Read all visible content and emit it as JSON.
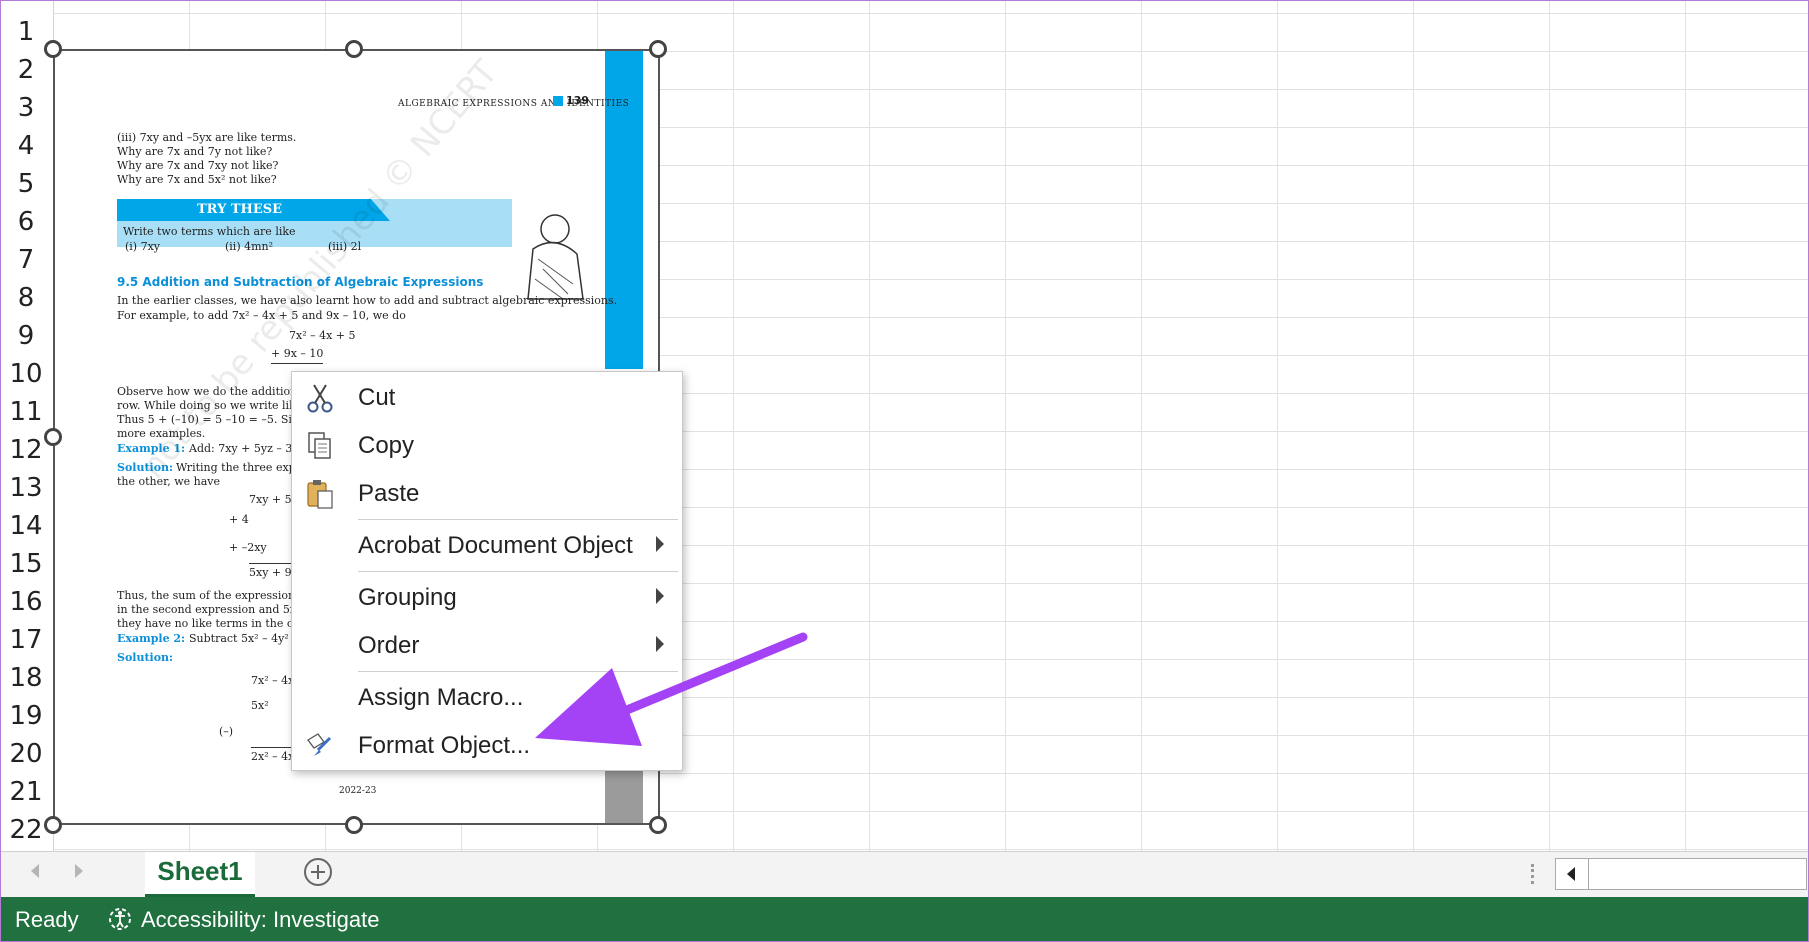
{
  "rows": [
    "1",
    "2",
    "3",
    "4",
    "5",
    "6",
    "7",
    "8",
    "9",
    "10",
    "11",
    "12",
    "13",
    "14",
    "15",
    "16",
    "17",
    "18",
    "19",
    "20",
    "21",
    "22"
  ],
  "document": {
    "header": "Algebraic Expressions and Identities",
    "page_num": "139",
    "lines_top": [
      "(iii)  7xy and –5yx are like terms.",
      "Why are 7x and 7y not like?",
      "Why are 7x and 7xy not like?",
      "Why are 7x and 5x² not like?"
    ],
    "try_title": "TRY THESE",
    "try_text": "Write two terms which are like",
    "try_items": [
      "(i)  7xy",
      "(ii)  4mn²",
      "(iii)  2l"
    ],
    "section_title": "9.5  Addition and Subtraction of Algebraic Expressions",
    "section_l1": "In the earlier classes, we have also learnt how to add and subtract algebraic expressions.",
    "section_l2": "For example, to add  7x² – 4x + 5 and 9x – 10, we do",
    "math1": "7x² – 4x + 5",
    "math2": "+          9x – 10",
    "obs_lines": [
      "Observe how we do the addition. We",
      "row. While doing so we write like ter",
      "Thus 5 + (–10) = 5 –10 = –5. Similar",
      "more examples."
    ],
    "ex1": "Example 1:",
    "ex1_text": "Add: 7xy + 5yz – 3zx",
    "sol1": "Solution:",
    "sol1_text": "Writing the three express",
    "sol1_l2": "the other, we have",
    "math3": "7xy + 5y",
    "math4": "+                4",
    "math5": "+  –2xy",
    "math6": "5xy + 9",
    "thus_lines": [
      "Thus, the sum of the expressions is 5x",
      "in the second expression and 5x in the t",
      "they have no like terms in the other exp"
    ],
    "ex2": "Example 2:",
    "ex2_text": "Subtract 5x² – 4y² + 6",
    "sol2": "Solution:",
    "math7": "7x² – 4x",
    "math8": "5x²",
    "math9": "(–)",
    "math10": "2x² – 4x",
    "footer": "2022-23",
    "watermark": "not to be republished © NCERT"
  },
  "context_menu": {
    "items": [
      {
        "label": "Cut",
        "icon": "scissors-icon"
      },
      {
        "label": "Copy",
        "icon": "copy-icon"
      },
      {
        "label": "Paste",
        "icon": "paste-icon"
      },
      {
        "label": "Acrobat Document Object",
        "icon": "",
        "submenu": true
      },
      {
        "label": "Grouping",
        "icon": "",
        "submenu": true
      },
      {
        "label": "Order",
        "icon": "",
        "submenu": true
      },
      {
        "label": "Assign Macro...",
        "icon": ""
      },
      {
        "label": "Format Object...",
        "icon": "format-brush-icon"
      }
    ]
  },
  "tabs": {
    "sheet": "Sheet1"
  },
  "status": {
    "ready": "Ready",
    "accessibility": "Accessibility: Investigate"
  },
  "colors": {
    "excel_green": "#21703f",
    "annotation_arrow": "#a442f5",
    "doc_blue": "#00a6e8"
  }
}
